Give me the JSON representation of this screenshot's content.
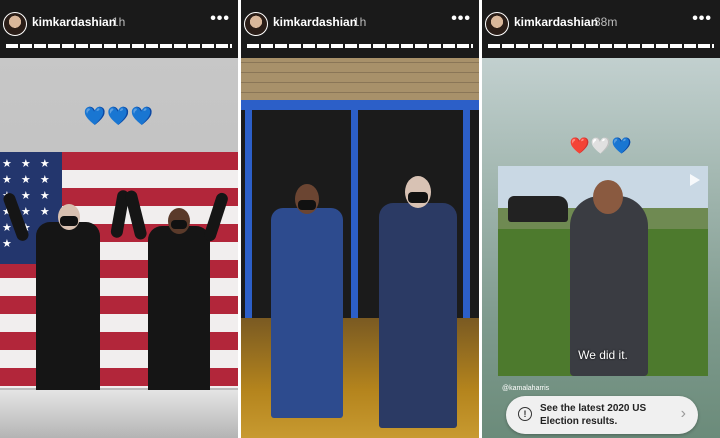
{
  "stories": [
    {
      "username": "kimkardashian",
      "time": "1h",
      "more": "•••",
      "emoji": "💙💙💙"
    },
    {
      "username": "kimkardashian",
      "time": "1h",
      "more": "•••"
    },
    {
      "username": "kimkardashian",
      "time": "38m",
      "more": "•••",
      "emoji": "❤️🤍💙",
      "video_caption": "We did it.",
      "mention": "@kamalaharris",
      "cta": {
        "icon": "!",
        "text": "See the latest 2020 US Election results."
      }
    }
  ],
  "colors": {
    "heart_blue": "#2f7fe3",
    "door_blue": "#2c5fc8",
    "flag_red": "#b2263a"
  }
}
